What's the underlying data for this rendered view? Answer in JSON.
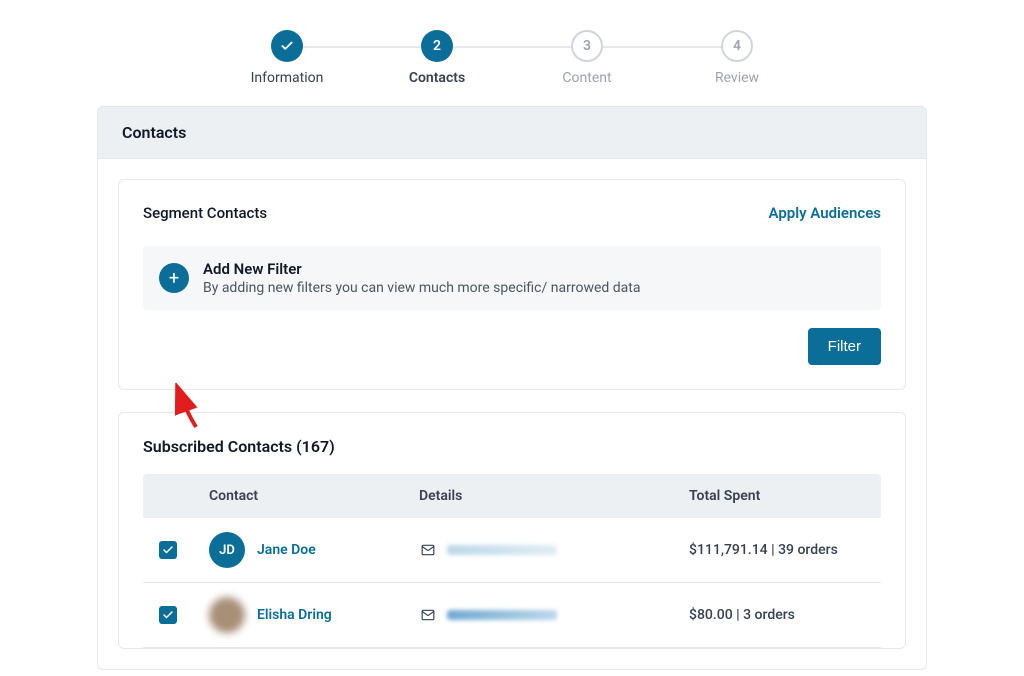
{
  "stepper": {
    "steps": [
      {
        "label": "Information",
        "state": "completed"
      },
      {
        "label": "Contacts",
        "state": "active",
        "num": "2"
      },
      {
        "label": "Content",
        "state": "pending",
        "num": "3"
      },
      {
        "label": "Review",
        "state": "pending",
        "num": "4"
      }
    ]
  },
  "panel": {
    "title": "Contacts"
  },
  "segment": {
    "title": "Segment Contacts",
    "apply_link": "Apply Audiences",
    "add_filter_title": "Add New Filter",
    "add_filter_desc": "By adding new filters you can view much more specific/ narrowed data",
    "filter_button": "Filter"
  },
  "subscribed": {
    "title": "Subscribed Contacts (167)",
    "headers": {
      "contact": "Contact",
      "details": "Details",
      "total": "Total Spent"
    },
    "rows": [
      {
        "initials": "JD",
        "name": "Jane Doe",
        "total": "$111,791.14 | 39 orders",
        "avatar_type": "initial"
      },
      {
        "initials": "",
        "name": "Elisha Dring",
        "total": "$80.00 | 3 orders",
        "avatar_type": "blur"
      }
    ]
  }
}
